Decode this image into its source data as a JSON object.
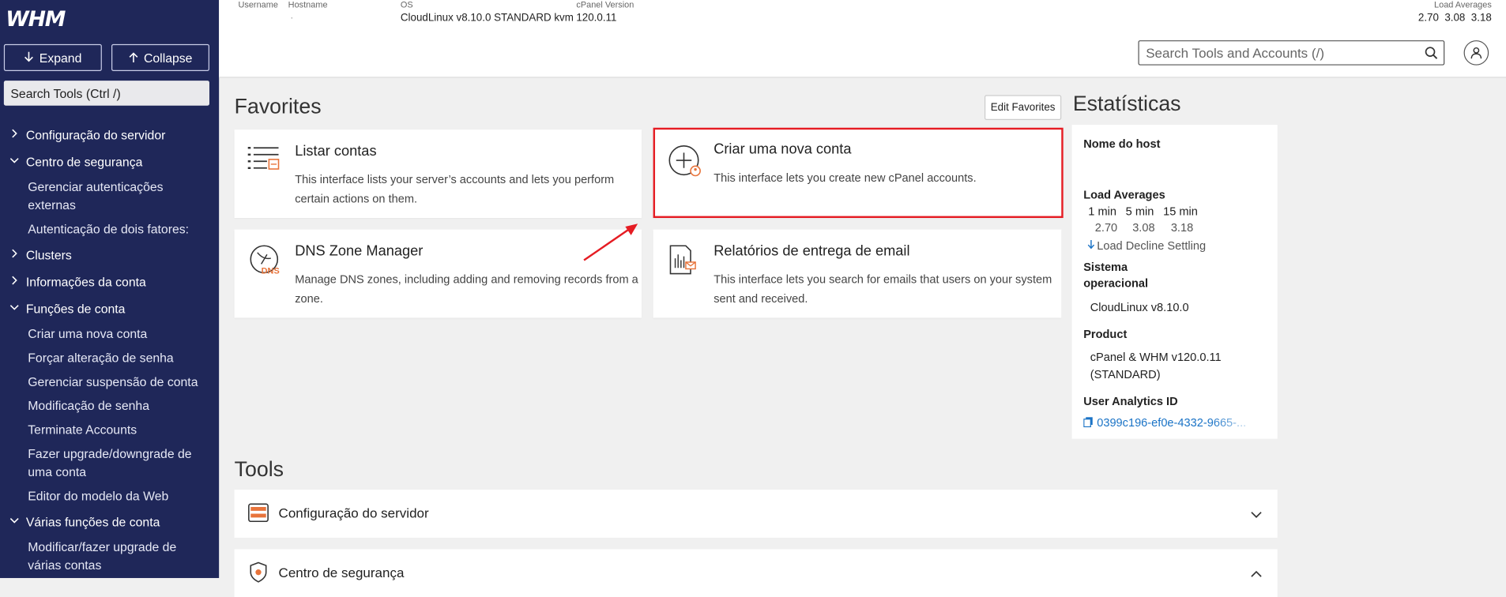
{
  "sidebar": {
    "logo": "WHM",
    "expand_label": "Expand",
    "collapse_label": "Collapse",
    "search_placeholder": "Search Tools (Ctrl /)",
    "nav": [
      {
        "label": "Configuração do servidor",
        "state": "collapsed"
      },
      {
        "label": "Centro de segurança",
        "state": "expanded"
      },
      {
        "sub": "Gerenciar autenticações externas"
      },
      {
        "sub": "Autenticação de dois fatores:"
      },
      {
        "label": "Clusters",
        "state": "collapsed"
      },
      {
        "label": "Informações da conta",
        "state": "collapsed"
      },
      {
        "label": "Funções de conta",
        "state": "expanded"
      },
      {
        "sub": "Criar uma nova conta"
      },
      {
        "sub": "Forçar alteração de senha"
      },
      {
        "sub": "Gerenciar suspensão de conta"
      },
      {
        "sub": "Modificação de senha"
      },
      {
        "sub": "Terminate Accounts"
      },
      {
        "sub": "Fazer upgrade/downgrade de uma conta"
      },
      {
        "sub": "Editor do modelo da Web"
      },
      {
        "label": "Várias funções de conta",
        "state": "expanded"
      },
      {
        "sub": "Modificar/fazer upgrade de várias contas"
      }
    ]
  },
  "topbar": {
    "username_label": "Username",
    "hostname_label": "Hostname",
    "hostname_value": "·",
    "os_label": "OS",
    "os_value": "CloudLinux v8.10.0 STANDARD kvm",
    "cpanel_label": "cPanel Version",
    "cpanel_value": "120.0.11",
    "load_label": "Load Averages",
    "load_values": "2.70  3.08  3.18",
    "search_placeholder": "Search Tools and Accounts (/)"
  },
  "favorites": {
    "title": "Favorites",
    "edit_label": "Edit Favorites",
    "cards": [
      {
        "title": "Listar contas",
        "desc": "This interface lists your server’s accounts and lets you perform certain actions on them.",
        "icon": "list-accounts-icon"
      },
      {
        "title": "Criar uma nova conta",
        "desc": "This interface lets you create new cPanel accounts.",
        "icon": "add-account-icon"
      },
      {
        "title": "DNS Zone Manager",
        "desc": "Manage DNS zones, including adding and removing records from a zone.",
        "icon": "dns-icon",
        "icon_text": "DNS"
      },
      {
        "title": "Relatórios de entrega de email",
        "desc": "This interface lets you search for emails that users on your system sent and received.",
        "icon": "email-report-icon"
      }
    ]
  },
  "stats": {
    "title": "Estatísticas",
    "host_label": "Nome do host",
    "load_label": "Load Averages",
    "load_headers": [
      "1 min",
      "5 min",
      "15 min"
    ],
    "load_values": [
      "2.70",
      "3.08",
      "3.18"
    ],
    "load_trend": "Load Decline Settling",
    "os_label_1": "Sistema",
    "os_label_2": "operacional",
    "os_value": "CloudLinux v8.10.0",
    "product_label": "Product",
    "product_value_1": "cPanel & WHM v120.0.11",
    "product_value_2": "(STANDARD)",
    "analytics_label": "User Analytics ID",
    "analytics_value": "0399c196-ef0e-4332-9665-..."
  },
  "tools": {
    "title": "Tools",
    "rows": [
      {
        "label": "Configuração do servidor",
        "state": "collapsed"
      },
      {
        "label": "Centro de segurança",
        "state": "expanded"
      }
    ]
  },
  "colors": {
    "sidebar_bg": "#1f2759",
    "highlight": "#e51c23",
    "accent_orange": "#e8743b",
    "link": "#1a73c6"
  }
}
